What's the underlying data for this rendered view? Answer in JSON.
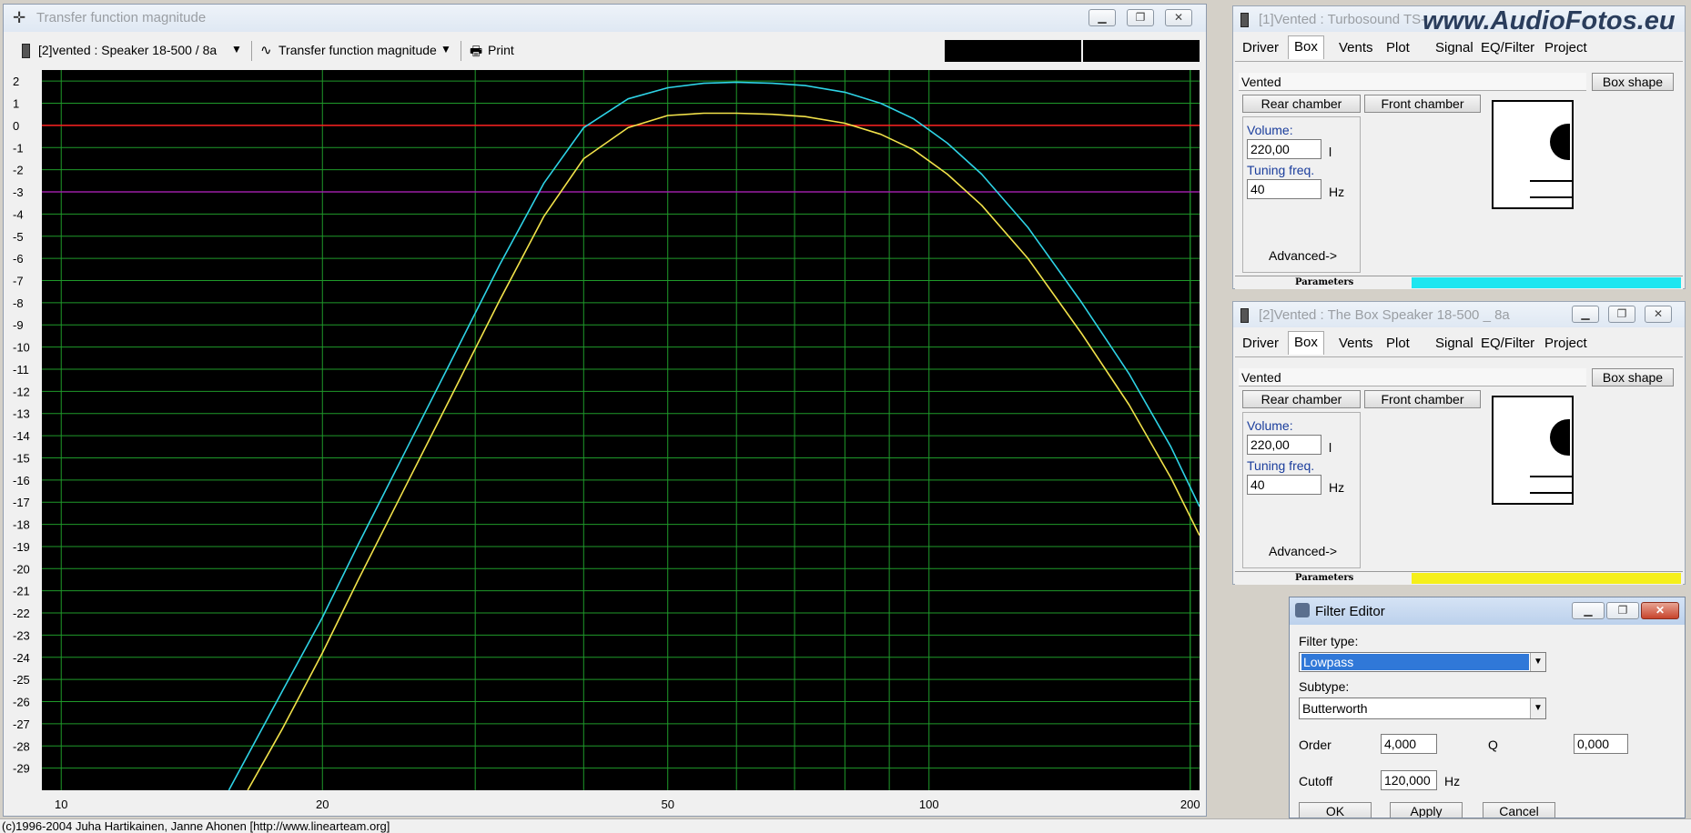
{
  "main_window": {
    "title": "Transfer function magnitude",
    "project_select": "[2]vented : Speaker 18-500  / 8a",
    "plot_select": "Transfer function magnitude",
    "print_label": "Print"
  },
  "chart_data": {
    "type": "line",
    "title": "",
    "xlabel": "",
    "ylabel": "",
    "xscale": "log",
    "xlim": [
      9.5,
      205
    ],
    "ylim": [
      -30,
      2.5
    ],
    "grid": true,
    "background": "#000000",
    "x_tick_labels": [
      "10",
      "20",
      "50",
      "100",
      "200"
    ],
    "y_tick_labels": [
      "2",
      "1",
      "0",
      "-1",
      "-2",
      "-3",
      "-4",
      "-5",
      "-6",
      "-7",
      "-8",
      "-9",
      "-10",
      "-11",
      "-12",
      "-13",
      "-14",
      "-15",
      "-16",
      "-17",
      "-18",
      "-19",
      "-20",
      "-21",
      "-22",
      "-23",
      "-24",
      "-25",
      "-26",
      "-27",
      "-28",
      "-29"
    ],
    "reference_lines": [
      {
        "y": 0,
        "color": "#ff2020"
      },
      {
        "y": -3,
        "color": "#9b1fa6"
      }
    ],
    "series": [
      {
        "color": "#2ed3e6",
        "x": [
          15.6,
          18,
          20,
          22,
          25,
          28,
          32,
          36,
          40,
          45,
          50,
          55,
          60,
          66,
          72,
          80,
          88,
          96,
          105,
          115,
          130,
          150,
          170,
          190,
          205
        ],
        "y": [
          -30,
          -25.5,
          -22.2,
          -18.9,
          -14.6,
          -10.8,
          -6.3,
          -2.6,
          -0.1,
          1.2,
          1.7,
          1.9,
          1.95,
          1.9,
          1.8,
          1.5,
          1.0,
          0.3,
          -0.8,
          -2.2,
          -4.6,
          -8.0,
          -11.2,
          -14.5,
          -17.2
        ]
      },
      {
        "color": "#f2e24a",
        "x": [
          16.4,
          18,
          20,
          22,
          25,
          28,
          32,
          36,
          40,
          45,
          50,
          55,
          60,
          66,
          72,
          80,
          88,
          96,
          105,
          115,
          130,
          150,
          170,
          190,
          205
        ],
        "y": [
          -30,
          -27.2,
          -23.8,
          -20.5,
          -16.2,
          -12.4,
          -7.9,
          -4.1,
          -1.5,
          -0.1,
          0.45,
          0.55,
          0.55,
          0.5,
          0.4,
          0.1,
          -0.4,
          -1.1,
          -2.2,
          -3.6,
          -6.0,
          -9.4,
          -12.6,
          -15.9,
          -18.5
        ]
      }
    ]
  },
  "box_win_1": {
    "title": "[1]Vented : Turbosound TS-",
    "watermark": "www.AudioFotos.eu",
    "tabs": [
      "Driver",
      "Box",
      "Vents",
      "Plot",
      "Signal",
      "EQ/Filter",
      "Project"
    ],
    "box_type": "Vented",
    "box_shape_btn": "Box shape",
    "rear_btn": "Rear chamber",
    "front_btn": "Front chamber",
    "volume_label": "Volume:",
    "volume_value": "220,00",
    "volume_unit": "l",
    "tuning_label": "Tuning freq.",
    "tuning_value": "40",
    "tuning_unit": "Hz",
    "advanced": "Advanced->",
    "params_label": "Parameters",
    "params_color": "#1ee6f0"
  },
  "box_win_2": {
    "title": "[2]Vented : The Box Speaker 18-500 _ 8a",
    "tabs": [
      "Driver",
      "Box",
      "Vents",
      "Plot",
      "Signal",
      "EQ/Filter",
      "Project"
    ],
    "box_type": "Vented",
    "box_shape_btn": "Box shape",
    "rear_btn": "Rear chamber",
    "front_btn": "Front chamber",
    "volume_label": "Volume:",
    "volume_value": "220,00",
    "volume_unit": "l",
    "tuning_label": "Tuning freq.",
    "tuning_value": "40",
    "tuning_unit": "Hz",
    "advanced": "Advanced->",
    "params_label": "Parameters",
    "params_color": "#f5ef1a"
  },
  "filter_editor": {
    "title": "Filter Editor",
    "filter_type_label": "Filter type:",
    "filter_type_value": "Lowpass",
    "subtype_label": "Subtype:",
    "subtype_value": "Butterworth",
    "order_label": "Order",
    "order_value": "4,000",
    "q_label": "Q",
    "q_value": "0,000",
    "cutoff_label": "Cutoff",
    "cutoff_value": "120,000",
    "cutoff_unit": "Hz",
    "ok": "OK",
    "apply": "Apply",
    "cancel": "Cancel"
  },
  "status_bar": {
    "text": "(c)1996-2004 Juha Hartikainen, Janne Ahonen [http://www.linearteam.org]"
  }
}
